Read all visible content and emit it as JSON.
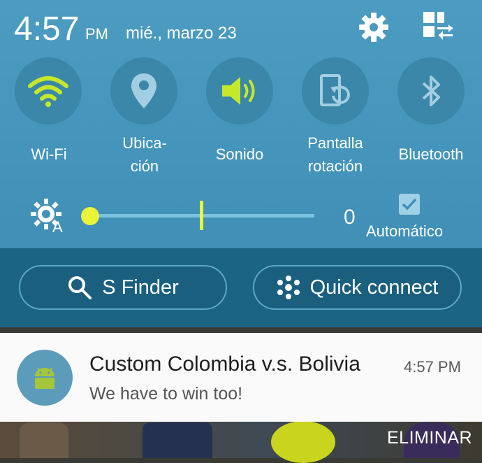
{
  "status": {
    "time": "4:57",
    "ampm": "PM",
    "date": "mié., marzo 23"
  },
  "header_icons": {
    "settings": "gear-icon",
    "edit": "grid-edit-icon"
  },
  "toggles": [
    {
      "label": "Wi-Fi",
      "icon": "wifi-icon",
      "active": true
    },
    {
      "label": "Ubica-\nción",
      "icon": "location-icon",
      "active": false
    },
    {
      "label": "Sonido",
      "icon": "sound-icon",
      "active": true
    },
    {
      "label": "Pantalla\nrotación",
      "icon": "rotation-icon",
      "active": false
    },
    {
      "label": "Bluetooth",
      "icon": "bluetooth-icon",
      "active": false
    }
  ],
  "brightness": {
    "value": "0",
    "level": 0.0,
    "auto_label": "Automático",
    "auto_checked": true
  },
  "actions": {
    "sfinder": "S Finder",
    "quick_connect": "Quick connect"
  },
  "notification": {
    "title": "Custom Colombia v.s. Bolivia",
    "time": "4:57 PM",
    "body": "We have to win too!",
    "icon": "android-icon"
  },
  "clear_label": "ELIMINAR",
  "colors": {
    "panel": "#4c9cc2",
    "active_accent": "#c6e82b",
    "lower_bar": "#1c6484"
  }
}
